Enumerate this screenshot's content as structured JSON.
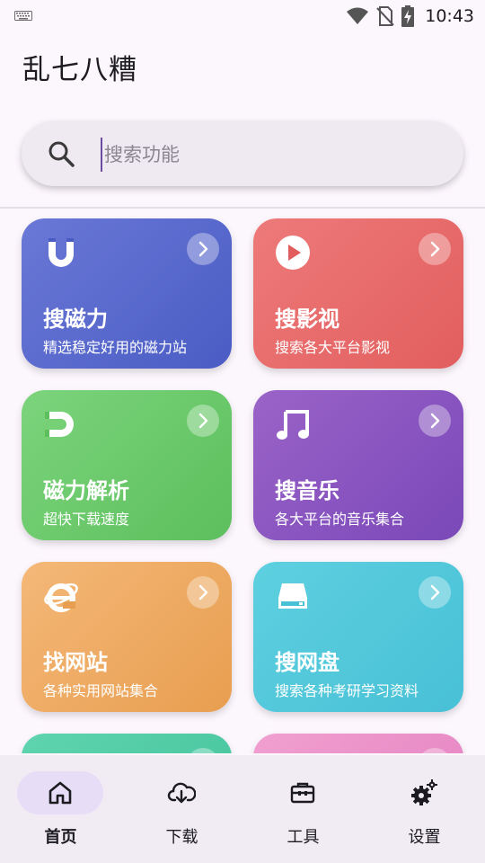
{
  "status_bar": {
    "time": "10:43",
    "icons": [
      "keyboard-icon",
      "wifi-icon",
      "no-sim-icon",
      "battery-charging-icon"
    ]
  },
  "app": {
    "title": "乱七八糟"
  },
  "search": {
    "placeholder": "搜索功能",
    "icon": "search-icon"
  },
  "cards": [
    {
      "title": "搜磁力",
      "desc": "精选稳定好用的磁力站",
      "icon": "magnet-icon",
      "color": "#5a69cc"
    },
    {
      "title": "搜影视",
      "desc": "搜索各大平台影视",
      "icon": "play-circle-icon",
      "color": "#e86a6a"
    },
    {
      "title": "磁力解析",
      "desc": "超快下载速度",
      "icon": "magnet-side-icon",
      "color": "#6cc96c"
    },
    {
      "title": "搜音乐",
      "desc": "各大平台的音乐集合",
      "icon": "music-note-icon",
      "color": "#8a55c0"
    },
    {
      "title": "找网站",
      "desc": "各种实用网站集合",
      "icon": "ie-browser-icon",
      "color": "#eeab62"
    },
    {
      "title": "搜网盘",
      "desc": "搜索各种考研学习资料",
      "icon": "storage-drive-icon",
      "color": "#52c8db"
    },
    {
      "title": "",
      "desc": "",
      "icon": "",
      "color": "#50cba4"
    },
    {
      "title": "",
      "desc": "",
      "icon": "",
      "color": "#ea8fc8"
    }
  ],
  "bottom_nav": {
    "items": [
      {
        "label": "首页",
        "icon": "home-icon",
        "active": true
      },
      {
        "label": "下载",
        "icon": "cloud-download-icon",
        "active": false
      },
      {
        "label": "工具",
        "icon": "toolbox-icon",
        "active": false
      },
      {
        "label": "设置",
        "icon": "settings-gears-icon",
        "active": false
      }
    ]
  }
}
